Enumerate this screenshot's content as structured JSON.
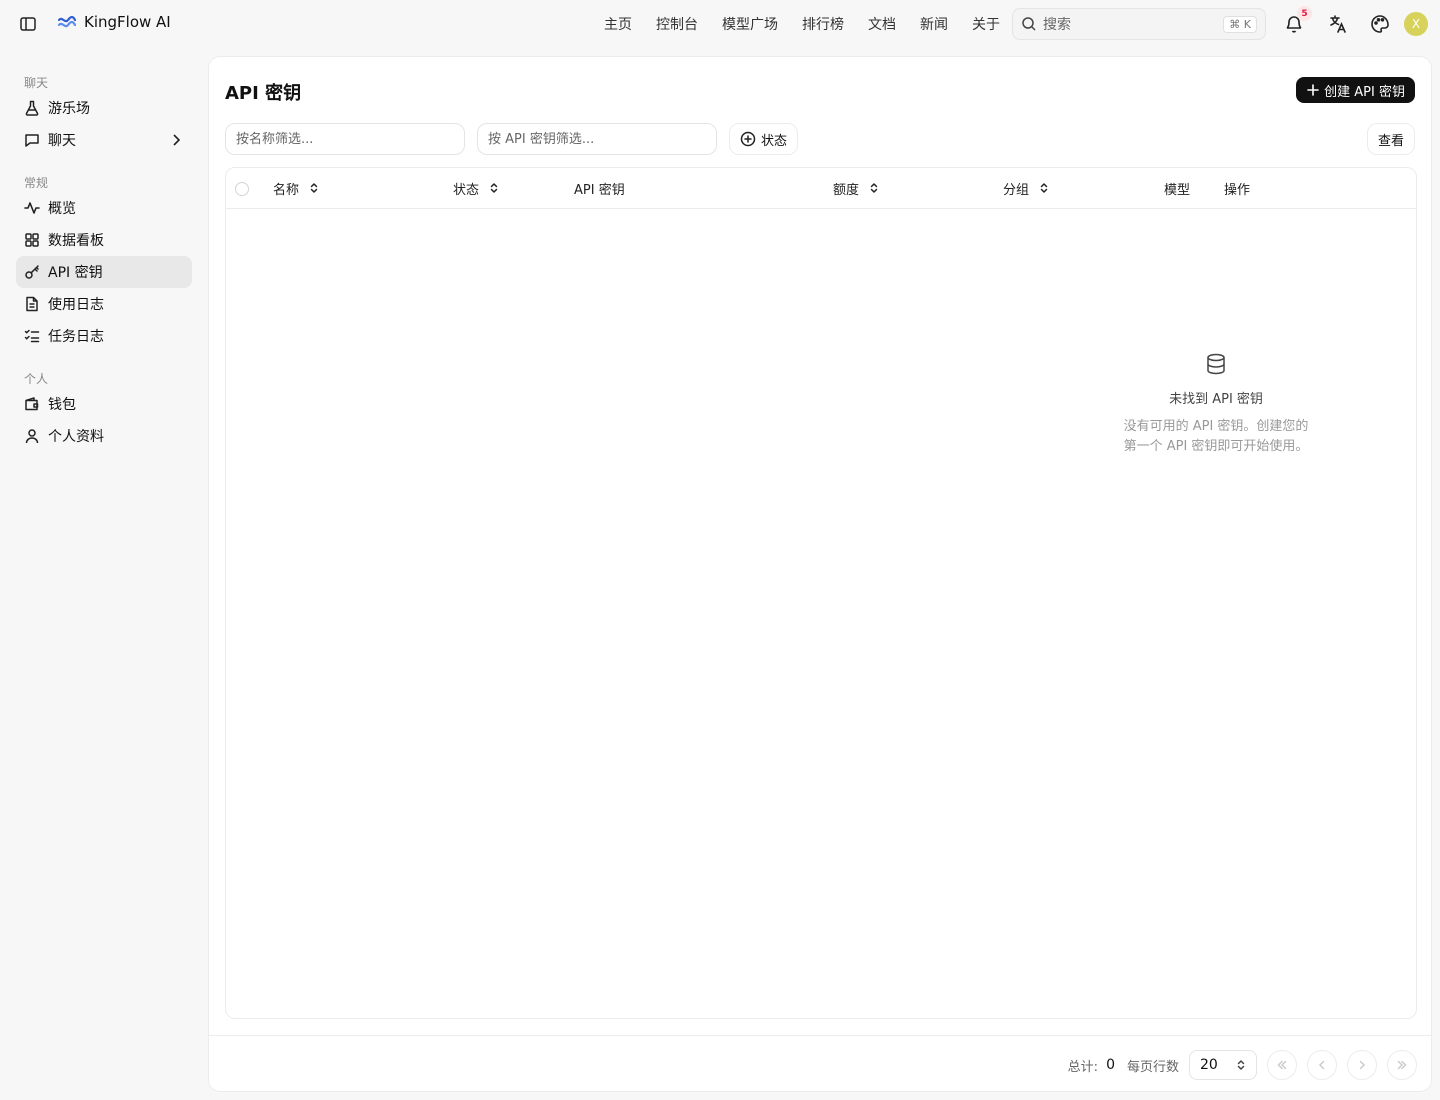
{
  "header": {
    "brand": "KingFlow AI",
    "nav": [
      "主页",
      "控制台",
      "模型广场",
      "排行榜",
      "文档",
      "新闻",
      "关于"
    ],
    "search_placeholder": "搜索",
    "search_shortcut": "⌘ K",
    "notification_count": "5",
    "avatar_initial": "X"
  },
  "sidebar": {
    "groups": [
      {
        "label": "聊天",
        "items": [
          {
            "label": "游乐场",
            "icon": "flask-icon"
          },
          {
            "label": "聊天",
            "icon": "message-icon"
          }
        ]
      },
      {
        "label": "常规",
        "items": [
          {
            "label": "概览",
            "icon": "activity-icon"
          },
          {
            "label": "数据看板",
            "icon": "dashboard-icon"
          },
          {
            "label": "API 密钥",
            "icon": "key-icon"
          },
          {
            "label": "使用日志",
            "icon": "file-text-icon"
          },
          {
            "label": "任务日志",
            "icon": "list-checks-icon"
          }
        ]
      },
      {
        "label": "个人",
        "items": [
          {
            "label": "钱包",
            "icon": "wallet-icon"
          },
          {
            "label": "个人资料",
            "icon": "user-icon"
          }
        ]
      }
    ],
    "active": "API 密钥"
  },
  "main": {
    "title": "API 密钥",
    "create_button": "创建 API 密钥",
    "filter_name_placeholder": "按名称筛选...",
    "filter_key_placeholder": "按 API 密钥筛选...",
    "status_filter": "状态",
    "view_button": "查看",
    "columns": [
      "名称",
      "状态",
      "API 密钥",
      "额度",
      "分组",
      "模型",
      "操作"
    ],
    "empty_title": "未找到 API 密钥",
    "empty_description": "没有可用的 API 密钥。创建您的\n第一个 API 密钥即可开始使用。"
  },
  "footer": {
    "total_label": "总计:",
    "total_value": "0",
    "rows_per_page_label": "每页行数",
    "rows_per_page_value": "20"
  },
  "colors": {
    "accent": "#111111",
    "avatar": "#d6d25a",
    "badge_text": "#e11d48",
    "active_bg": "#e8e8e8"
  }
}
